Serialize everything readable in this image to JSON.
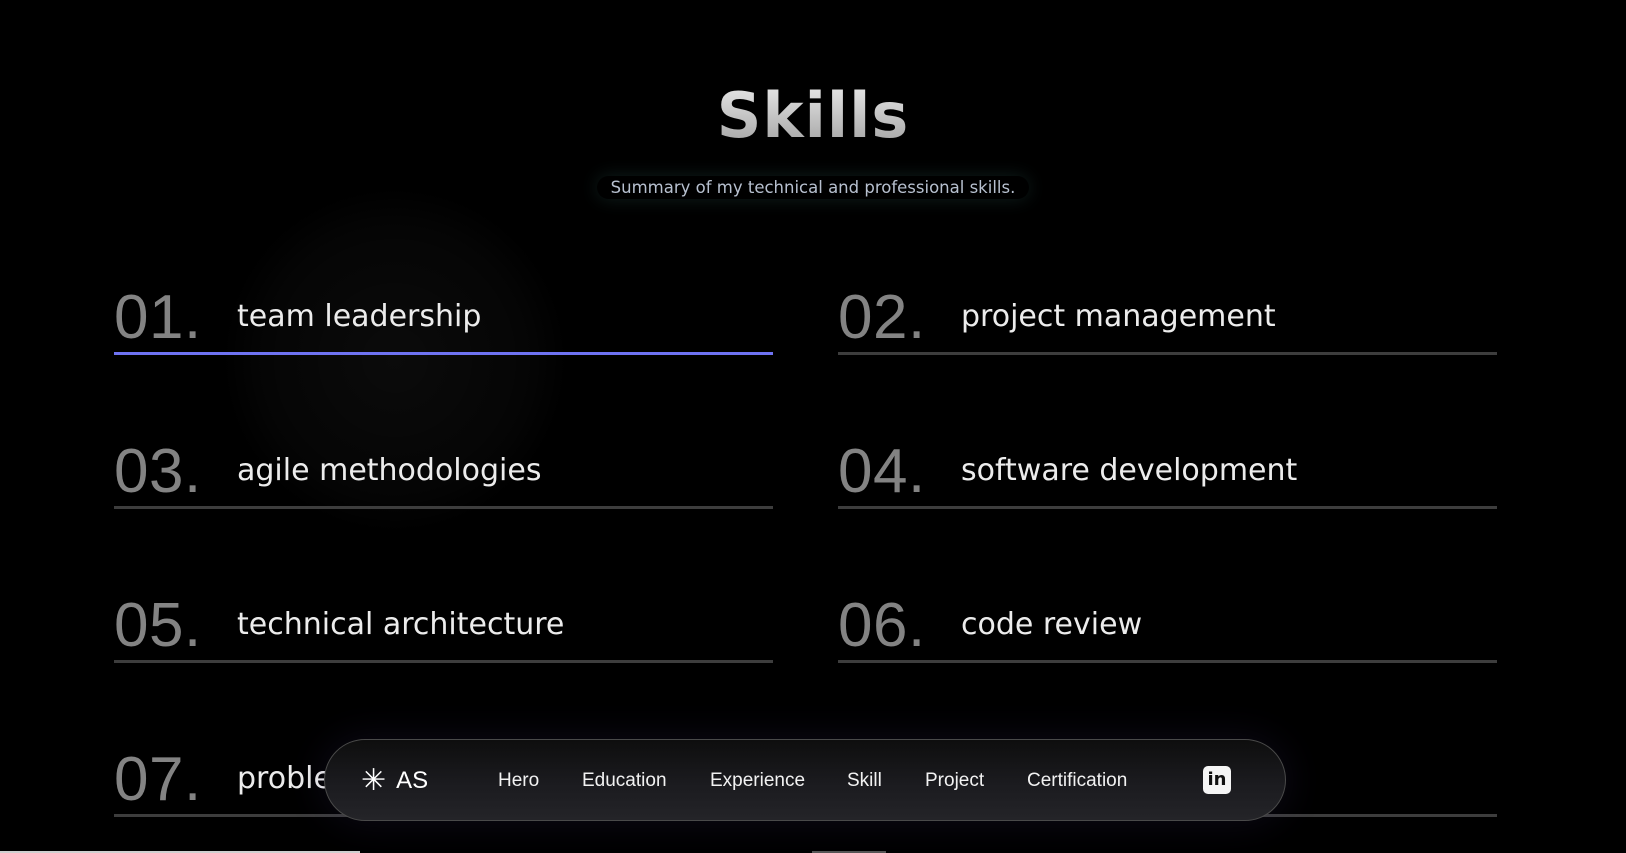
{
  "section": {
    "title": "Skills",
    "subtitle": "Summary of my technical and professional skills."
  },
  "skills": [
    {
      "num": "01.",
      "label": "team leadership"
    },
    {
      "num": "02.",
      "label": "project management"
    },
    {
      "num": "03.",
      "label": "agile methodologies"
    },
    {
      "num": "04.",
      "label": "software development"
    },
    {
      "num": "05.",
      "label": "technical architecture"
    },
    {
      "num": "06.",
      "label": "code review"
    },
    {
      "num": "07.",
      "label": "proble"
    }
  ],
  "navbar": {
    "brand_icon": "✳",
    "brand_name": "AS",
    "links": [
      "Hero",
      "Education",
      "Experience",
      "Skill",
      "Project",
      "Certification"
    ],
    "linkedin_icon": "in"
  },
  "colors": {
    "background": "#000000",
    "active_underline": "#6f73f2",
    "underline": "#3d3d3d",
    "number": "#838383",
    "label": "#ececec"
  }
}
